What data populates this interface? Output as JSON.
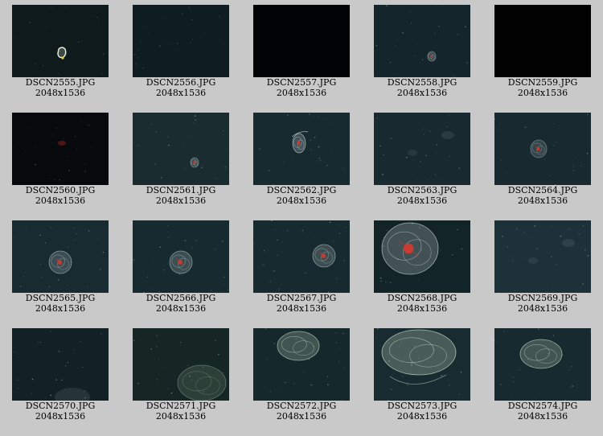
{
  "gallery": {
    "items": [
      {
        "name": "DSCN2555.JPG",
        "dims": "2048x1536",
        "bg": "#0e1a1c",
        "subject": "small-bright"
      },
      {
        "name": "DSCN2556.JPG",
        "dims": "2048x1536",
        "bg": "#0f1d22",
        "subject": "none"
      },
      {
        "name": "DSCN2557.JPG",
        "dims": "2048x1536",
        "bg": "#020304",
        "subject": "none"
      },
      {
        "name": "DSCN2558.JPG",
        "dims": "2048x1536",
        "bg": "#14262c",
        "subject": "small-red"
      },
      {
        "name": "DSCN2559.JPG",
        "dims": "2048x1536",
        "bg": "#010101",
        "subject": "none"
      },
      {
        "name": "DSCN2560.JPG",
        "dims": "2048x1536",
        "bg": "#07090c",
        "subject": "faint-red"
      },
      {
        "name": "DSCN2561.JPG",
        "dims": "2048x1536",
        "bg": "#1b2c31",
        "subject": "small-red"
      },
      {
        "name": "DSCN2562.JPG",
        "dims": "2048x1536",
        "bg": "#172a30",
        "subject": "shrimp"
      },
      {
        "name": "DSCN2563.JPG",
        "dims": "2048x1536",
        "bg": "#182a2f",
        "subject": "faint"
      },
      {
        "name": "DSCN2564.JPG",
        "dims": "2048x1536",
        "bg": "#182a30",
        "subject": "jelly-small"
      },
      {
        "name": "DSCN2565.JPG",
        "dims": "2048x1536",
        "bg": "#182b31",
        "subject": "jelly-red"
      },
      {
        "name": "DSCN2566.JPG",
        "dims": "2048x1536",
        "bg": "#172a30",
        "subject": "jelly-red"
      },
      {
        "name": "DSCN2567.JPG",
        "dims": "2048x1536",
        "bg": "#172a2f",
        "subject": "jelly-red"
      },
      {
        "name": "DSCN2568.JPG",
        "dims": "2048x1536",
        "bg": "#132429",
        "subject": "jelly-big"
      },
      {
        "name": "DSCN2569.JPG",
        "dims": "2048x1536",
        "bg": "#1d3238",
        "subject": "faint"
      },
      {
        "name": "DSCN2570.JPG",
        "dims": "2048x1536",
        "bg": "#132126",
        "subject": "faint-bottom"
      },
      {
        "name": "DSCN2571.JPG",
        "dims": "2048x1536",
        "bg": "#162625",
        "subject": "green-bottom"
      },
      {
        "name": "DSCN2572.JPG",
        "dims": "2048x1536",
        "bg": "#15282c",
        "subject": "green-jelly"
      },
      {
        "name": "DSCN2573.JPG",
        "dims": "2048x1536",
        "bg": "#182b30",
        "subject": "green-big"
      },
      {
        "name": "DSCN2574.JPG",
        "dims": "2048x1536",
        "bg": "#172a2f",
        "subject": "green-jelly"
      }
    ]
  }
}
